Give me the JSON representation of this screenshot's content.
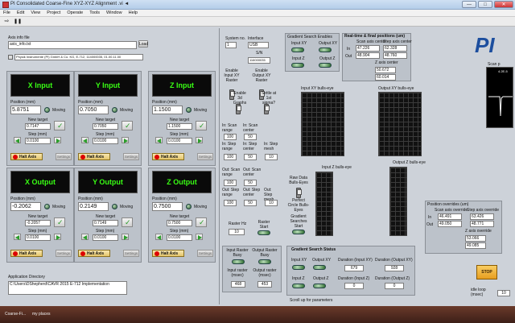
{
  "window": {
    "title": "PI Consolidated Coarse-Fine XYZ-XYZ Alignment .vi ◄",
    "min": "—",
    "max": "□",
    "close": "✕"
  },
  "menu": [
    "File",
    "Edit",
    "View",
    "Project",
    "Operate",
    "Tools",
    "Window",
    "Help"
  ],
  "toolbar": {
    "run": "⇨",
    "pause": "❚❚"
  },
  "config": {
    "label": "Axis info file",
    "value": "axis_info.txt",
    "browse": "Load",
    "device": "Physik Instrumente (PI) GmbH & Co. KG, E-712, 114000035, 01.00.11.00"
  },
  "axes": [
    {
      "title": "X Input",
      "position_label": "Position (mm)",
      "position": "5.8751",
      "status": "Moving",
      "new_target_label": "New target",
      "new_target": "0.7147",
      "step_label": "Step (mm)",
      "step": "0.0100",
      "halt": "Halt Axis",
      "settings": "Settings"
    },
    {
      "title": "Y Input",
      "position_label": "Position (mm)",
      "position": "0.7050",
      "status": "Moving",
      "new_target_label": "New target",
      "new_target": "0.7050",
      "step_label": "Step (mm)",
      "step": "0.0100",
      "halt": "Halt Axis",
      "settings": "Settings"
    },
    {
      "title": "Z Input",
      "position_label": "Position (mm)",
      "position": "1.1500",
      "status": "Moving",
      "new_target_label": "New target",
      "new_target": "1.1500",
      "step_label": "Step (mm)",
      "step": "0.0100",
      "halt": "Halt Axis",
      "settings": "Settings"
    },
    {
      "title": "X Output",
      "position_label": "Position (mm)",
      "position": "-0.2062",
      "status": "Moving",
      "new_target_label": "New target",
      "new_target": "-0.2057",
      "step_label": "Step (mm)",
      "step": "0.0100",
      "halt": "Halt Axis",
      "settings": "Settings"
    },
    {
      "title": "Y Output",
      "position_label": "Position (mm)",
      "position": "0.2149",
      "status": "Moving",
      "new_target_label": "New target",
      "new_target": "0.7149",
      "step_label": "Step (mm)",
      "step": "0.0100",
      "halt": "Halt Axis",
      "settings": "Settings"
    },
    {
      "title": "Z Output",
      "position_label": "Position (mm)",
      "position": "0.7500",
      "status": "Moving",
      "new_target_label": "New target",
      "new_target": "0.7500",
      "step_label": "Step (mm)",
      "step": "0.0100",
      "halt": "Halt Axis",
      "settings": "Settings"
    }
  ],
  "appdir": {
    "label": "Application Directory",
    "value": "C:\\Users\\DShepherd\\CAVR 2015 E-712 Implementation"
  },
  "system": {
    "sysno_label": "System no.",
    "sysno": "1",
    "interface_label": "Interface",
    "interface": "USB",
    "sn_label": "S/N",
    "sn": "116000035"
  },
  "enables": {
    "input_xy": "Enable Input XY Raster",
    "output_xy": "Enable Output XY Raster",
    "graphs": "Enable 3d Graphs",
    "settle": "Settle at 1st sigma?"
  },
  "scan": {
    "in_scan_range_label": "In: Scan range",
    "in_scan_range": "100",
    "in_scan_center_label": "In: Scan center",
    "in_scan_center": "50",
    "in_step_range_label": "In: Step range",
    "in_step_range": "100",
    "in_step_center_label": "In: Step center",
    "in_step_center": "50",
    "in_step_mesh_label": "In: Step mesh",
    "in_step_mesh": "10",
    "out_scan_range_label": "Out: Scan range",
    "out_scan_range": "100",
    "out_scan_center_label": "Out: Scan center",
    "out_scan_center": "50",
    "out_step_range_label": "Out: Step range",
    "out_step_range": "100",
    "out_step_center_label": "Out: Step center",
    "out_step_center": "50",
    "out_step_mesh_label": "Out: Step mesh",
    "out_step_mesh": "10",
    "raster_hz_label": "Raster Hz",
    "raster_hz": "10",
    "raster_start": "Raster Start"
  },
  "raster_busy": {
    "input_label": "Input Raster Busy",
    "output_label": "Output Raster Busy",
    "in_msec_label": "Input raster (msec)",
    "in_msec": "468",
    "out_msec_label": "Output raster (msec)",
    "out_msec": "453"
  },
  "gradient": {
    "enables_label": "Gradient Search Enables",
    "input_xy": "Input XY",
    "output_xy": "Output XY",
    "input_z": "Input Z",
    "output_z": "Output Z"
  },
  "bullseye": {
    "input_xy": "Input XY bulls-eye",
    "output_xy": "Output XY bulls-eye",
    "input_z": "Input Z bulls-eye",
    "output_z": "Output Z bulls-eye",
    "raw_data": "Raw Data Bulls-Eyes",
    "perfect_circle": "Perfect Circle Bulls-Eyes",
    "gradient_start": "Gradient Searches Start"
  },
  "search_status": {
    "label": "Gradient Search Status",
    "input_xy": "Input XY",
    "output_xy": "Output XY",
    "input_z": "Input Z",
    "output_z": "Output Z",
    "dur_in_xy_label": "Duration (Input XY)",
    "dur_in_xy": "679",
    "dur_out_xy_label": "Duration (Output XY)",
    "dur_out_xy": "928",
    "dur_in_z_label": "Duration (Input Z)",
    "dur_in_z": "0",
    "dur_out_z_label": "Duration (Output Z)",
    "dur_out_z": "0",
    "scroll_note": "Scroll up for parameters"
  },
  "realtime": {
    "label": "Real-time & final positions (um)",
    "scan_label": "Scan axis center",
    "step_label": "Step axis center",
    "in_label": "In",
    "out_label": "Out",
    "in_scan": "47.226",
    "in_step": "62.328",
    "out_scan": "48.904",
    "out_step": "48.760",
    "z_label": "Z axis center",
    "z_in": "50.672",
    "z_out": "60.014"
  },
  "logo": "PI",
  "mini_chart": {
    "label": "Scan p",
    "value": "4.2E-5"
  },
  "overrides": {
    "label": "Position overrides (um)",
    "scan_label": "Scan axis override",
    "step_label": "Step axis override",
    "in_label": "In",
    "out_label": "Out",
    "in_scan": "46.491",
    "in_step": "63.426",
    "out_scan": "49.050",
    "out_step": "48.771",
    "z_label": "Z axis override",
    "z_in": "53.066",
    "z_out": "49.085"
  },
  "stop": "STOP",
  "idle": {
    "label": "idle loop (msec)",
    "value": "10"
  },
  "taskbar": {
    "app": "Coarse-Fi...",
    "tab": "my places"
  },
  "colors": {
    "panel": "#cdd2d9",
    "axis_title": "#39ff14",
    "stop": "#f2b53a",
    "halt": "#e3c56a"
  }
}
